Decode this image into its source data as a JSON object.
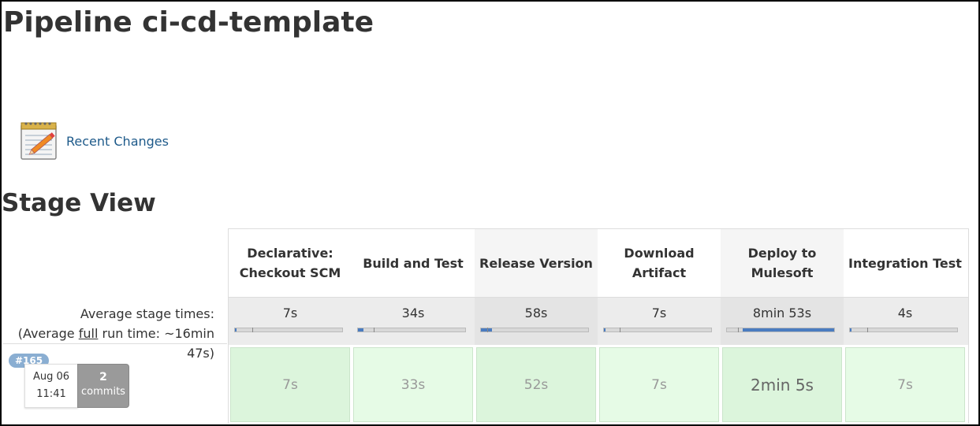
{
  "page_title": "Pipeline ci-cd-template",
  "recent_changes": {
    "label": "Recent Changes",
    "icon": "notepad-pencil-icon"
  },
  "stage_view": {
    "title": "Stage View",
    "stages": [
      {
        "name": "Declarative: Checkout SCM",
        "avg": "7s",
        "avg_fill": 0.0,
        "run": "7s"
      },
      {
        "name": "Build and Test",
        "avg": "34s",
        "avg_fill": 0.05,
        "run": "33s"
      },
      {
        "name": "Release Version",
        "avg": "58s",
        "avg_fill": 0.1,
        "run": "52s"
      },
      {
        "name": "Download Artifact",
        "avg": "7s",
        "avg_fill": 0.0,
        "run": "7s"
      },
      {
        "name": "Deploy to Mulesoft",
        "avg": "8min 53s",
        "avg_fill": 0.85,
        "run": "2min 5s"
      },
      {
        "name": "Integration Test",
        "avg": "4s",
        "avg_fill": 0.0,
        "run": "7s"
      }
    ],
    "avg_label_line1": "Average stage times:",
    "avg_label_prefix": "(Average ",
    "avg_label_full": "full",
    "avg_label_suffix": " run time: ~16min",
    "avg_label_line3": "47s)",
    "build": {
      "number": "#165",
      "date": "Aug 06",
      "time": "11:41",
      "commits_count": "2",
      "commits_label": "commits"
    }
  },
  "colors": {
    "link": "#1e5a8a",
    "run_success": "#e6fbe6",
    "progress": "#4a7cc0",
    "badge": "#8aaed2"
  }
}
